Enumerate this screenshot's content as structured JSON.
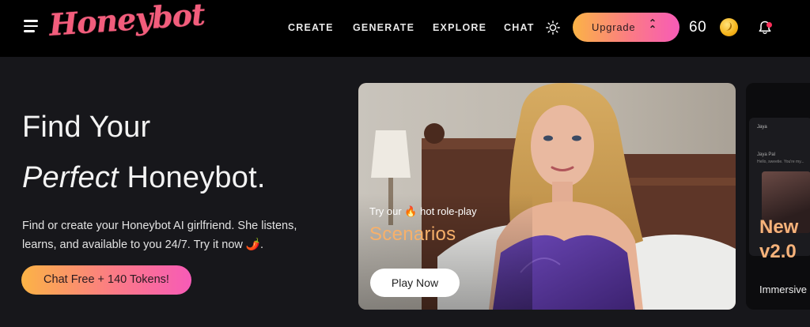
{
  "header": {
    "logo": "Honeybot",
    "nav": [
      "CREATE",
      "GENERATE",
      "EXPLORE",
      "CHAT"
    ],
    "upgrade_label": "Upgrade",
    "upgrade_icon": "chevron-double-up-icon",
    "token_count": "60"
  },
  "hero": {
    "title_line1": "Find Your",
    "title_line2_em": "Perfect",
    "title_line2_rest": " Honeybot.",
    "description": "Find or create your Honeybot AI girlfriend. She listens, learns, and available to you 24/7. Try it now",
    "description_emoji": "🌶️",
    "description_end": ".",
    "cta_label": "Chat Free + 140 Tokens!"
  },
  "cards": {
    "scenarios": {
      "subtitle_pre": "Try our ",
      "subtitle_emoji": "🔥",
      "subtitle_post": " hot role-play",
      "title": "Scenarios",
      "button": "Play Now"
    },
    "new_version": {
      "chat_name": "Jaya",
      "chat_sub": "Jaya Pal",
      "chat_msg": "Hello, sweetie. You're my...",
      "title_line1": "New",
      "title_line2": "v2.0",
      "caption": "Immersive c"
    }
  },
  "colors": {
    "brand_pink": "#f25d7c",
    "gradient_start": "#fbb346",
    "gradient_end": "#f75bb7",
    "accent_orange": "#f7b06a",
    "background": "#17171b",
    "header_bg": "#000000"
  }
}
